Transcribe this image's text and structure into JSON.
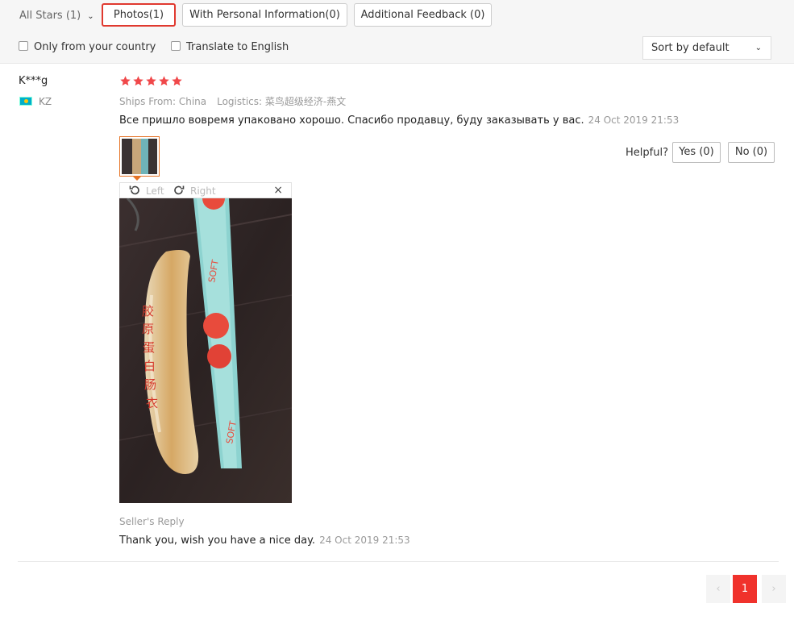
{
  "filters": {
    "all_stars": "All Stars (1)",
    "tabs": [
      {
        "label": "Photos(1)",
        "active": true
      },
      {
        "label": "With Personal Information(0)",
        "active": false
      },
      {
        "label": "Additional Feedback (0)",
        "active": false
      }
    ],
    "only_country": "Only from your country",
    "translate": "Translate to English",
    "sort": "Sort by default"
  },
  "review": {
    "user": "K***g",
    "country_code": "KZ",
    "rating": 5,
    "ships_from": "Ships From: China",
    "logistics": "Logistics: 菜鸟超级经济-燕文",
    "text": "Все пришло вовремя упаковано хорошо. Спасибо продавцу, буду заказывать у вас.",
    "date": "24 Oct 2019 21:53",
    "helpful_label": "Helpful?",
    "yes_label": "Yes (0)",
    "no_label": "No (0)",
    "viewer": {
      "left_label": "Left",
      "right_label": "Right",
      "close_glyph": "×"
    },
    "seller_reply_label": "Seller's Reply",
    "seller_reply_text": "Thank you, wish you have a nice day.",
    "seller_reply_date": "24 Oct 2019 21:53"
  },
  "pagination": {
    "prev": "‹",
    "current": "1",
    "next": "›"
  },
  "colors": {
    "accent": "#e0392f",
    "star": "#f0484a",
    "page_active": "#f0322c",
    "thumb_border": "#e57326"
  }
}
